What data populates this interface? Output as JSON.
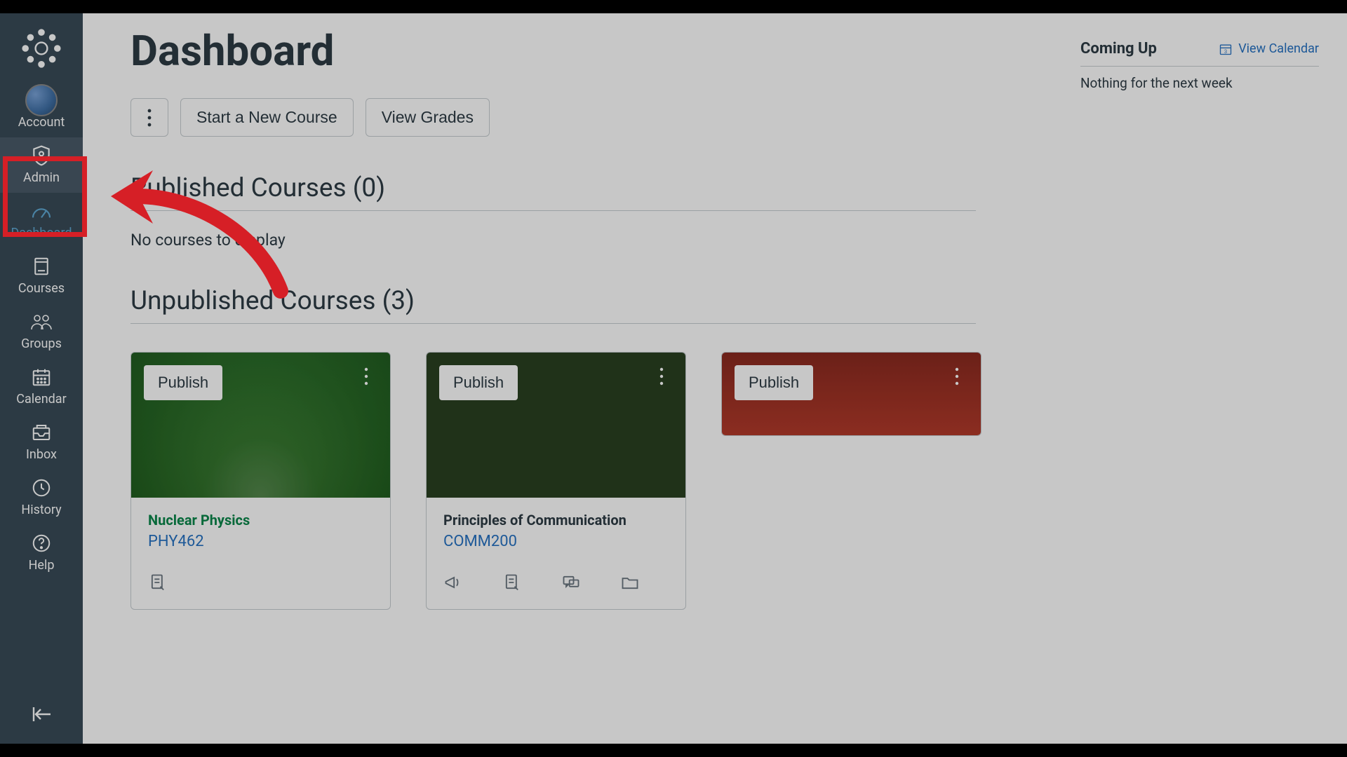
{
  "sidebar": {
    "items": [
      {
        "id": "account",
        "label": "Account",
        "icon": "avatar"
      },
      {
        "id": "admin",
        "label": "Admin",
        "icon": "shield"
      },
      {
        "id": "dashboard",
        "label": "Dashboard",
        "icon": "speedometer"
      },
      {
        "id": "courses",
        "label": "Courses",
        "icon": "book"
      },
      {
        "id": "groups",
        "label": "Groups",
        "icon": "people"
      },
      {
        "id": "calendar",
        "label": "Calendar",
        "icon": "calendar"
      },
      {
        "id": "inbox",
        "label": "Inbox",
        "icon": "inbox"
      },
      {
        "id": "history",
        "label": "History",
        "icon": "clock"
      },
      {
        "id": "help",
        "label": "Help",
        "icon": "question"
      }
    ],
    "active": "dashboard",
    "highlighted": "admin"
  },
  "header": {
    "title": "Dashboard",
    "buttons": {
      "start_course": "Start a New Course",
      "view_grades": "View Grades"
    }
  },
  "sections": {
    "published": {
      "title": "Published Courses (0)",
      "empty_message": "No courses to display"
    },
    "unpublished": {
      "title": "Unpublished Courses (3)"
    }
  },
  "courses": [
    {
      "name": "Nuclear Physics",
      "code": "PHY462",
      "name_color": "green",
      "img": "forest",
      "publish_label": "Publish",
      "footer_icons": [
        "assignments"
      ]
    },
    {
      "name": "Principles of Communication",
      "code": "COMM200",
      "name_color": "dark",
      "img": "darkgreen",
      "publish_label": "Publish",
      "footer_icons": [
        "announcements",
        "assignments",
        "discussions",
        "files"
      ]
    },
    {
      "name": "",
      "code": "",
      "name_color": "dark",
      "img": "books",
      "publish_label": "Publish",
      "footer_icons": []
    }
  ],
  "rhs": {
    "coming_up": "Coming Up",
    "view_calendar": "View Calendar",
    "nothing": "Nothing for the next week"
  },
  "annotation": {
    "highlight_target": "admin",
    "arrow": true
  }
}
